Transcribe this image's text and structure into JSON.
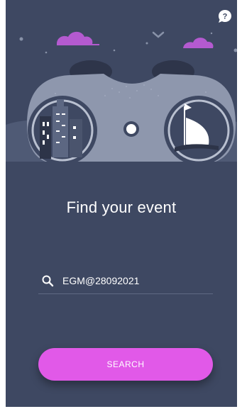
{
  "screen": {
    "title": "Find your event"
  },
  "search": {
    "value": "EGM@28092021",
    "placeholder": ""
  },
  "actions": {
    "search_label": "SEARCH"
  },
  "icons": {
    "help": "help-bubble-icon",
    "search": "search-icon"
  },
  "colors": {
    "background": "#3e4862",
    "accent": "#e159e8",
    "cloud": "#b45ad0",
    "illustration_light": "#8e97ad"
  }
}
